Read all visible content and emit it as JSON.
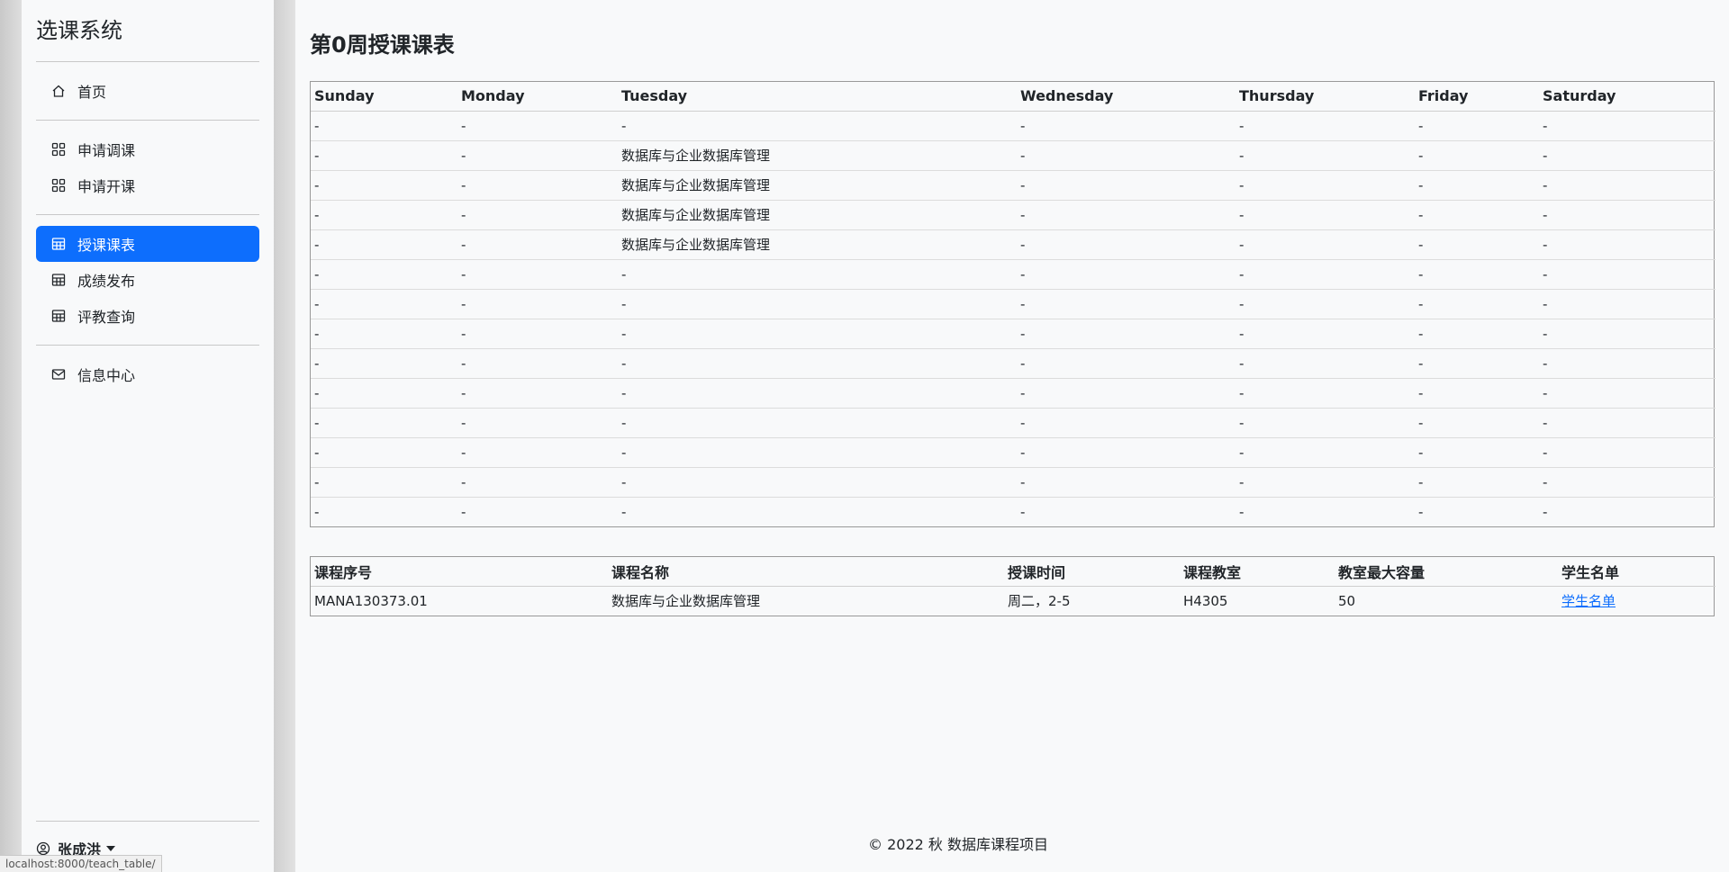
{
  "sidebar": {
    "brand": "选课系统",
    "groups": [
      [
        {
          "label": "首页",
          "icon": "home-icon"
        }
      ],
      [
        {
          "label": "申请调课",
          "icon": "grid-icon"
        },
        {
          "label": "申请开课",
          "icon": "grid-icon"
        }
      ],
      [
        {
          "label": "授课课表",
          "icon": "table-icon",
          "active": true
        },
        {
          "label": "成绩发布",
          "icon": "table-icon"
        },
        {
          "label": "评教查询",
          "icon": "table-icon"
        }
      ],
      [
        {
          "label": "信息中心",
          "icon": "envelope-icon"
        }
      ]
    ],
    "user": "张成洪"
  },
  "statusbar": {
    "url": "localhost:8000/teach_table/"
  },
  "main": {
    "title": "第0周授课课表",
    "schedule": {
      "headers": [
        "Sunday",
        "Monday",
        "Tuesday",
        "Wednesday",
        "Thursday",
        "Friday",
        "Saturday"
      ],
      "rows": [
        [
          "-",
          "-",
          "-",
          "-",
          "-",
          "-",
          "-"
        ],
        [
          "-",
          "-",
          "数据库与企业数据库管理",
          "-",
          "-",
          "-",
          "-"
        ],
        [
          "-",
          "-",
          "数据库与企业数据库管理",
          "-",
          "-",
          "-",
          "-"
        ],
        [
          "-",
          "-",
          "数据库与企业数据库管理",
          "-",
          "-",
          "-",
          "-"
        ],
        [
          "-",
          "-",
          "数据库与企业数据库管理",
          "-",
          "-",
          "-",
          "-"
        ],
        [
          "-",
          "-",
          "-",
          "-",
          "-",
          "-",
          "-"
        ],
        [
          "-",
          "-",
          "-",
          "-",
          "-",
          "-",
          "-"
        ],
        [
          "-",
          "-",
          "-",
          "-",
          "-",
          "-",
          "-"
        ],
        [
          "-",
          "-",
          "-",
          "-",
          "-",
          "-",
          "-"
        ],
        [
          "-",
          "-",
          "-",
          "-",
          "-",
          "-",
          "-"
        ],
        [
          "-",
          "-",
          "-",
          "-",
          "-",
          "-",
          "-"
        ],
        [
          "-",
          "-",
          "-",
          "-",
          "-",
          "-",
          "-"
        ],
        [
          "-",
          "-",
          "-",
          "-",
          "-",
          "-",
          "-"
        ],
        [
          "-",
          "-",
          "-",
          "-",
          "-",
          "-",
          "-"
        ]
      ]
    },
    "courses": {
      "headers": [
        "课程序号",
        "课程名称",
        "授课时间",
        "课程教室",
        "教室最大容量",
        "学生名单"
      ],
      "rows": [
        [
          "MANA130373.01",
          "数据库与企业数据库管理",
          "周二，2-5",
          "H4305",
          "50",
          "学生名单"
        ]
      ]
    },
    "footer": "© 2022 秋 数据库课程项目"
  }
}
